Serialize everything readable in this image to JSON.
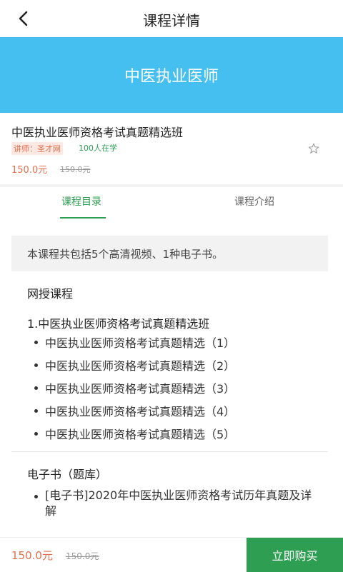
{
  "header": {
    "title": "课程详情"
  },
  "banner": {
    "text": "中医执业医师"
  },
  "course": {
    "name": "中医执业医师资格考试真题精选班",
    "teacher": "讲师：圣才网",
    "learners": "100人在学",
    "price": "150.0元",
    "original_price": "150.0元"
  },
  "tabs": [
    {
      "label": "课程目录"
    },
    {
      "label": "课程介绍"
    }
  ],
  "catalog": {
    "summary": "本课程共包括5个高清视频、1种电子书。",
    "online_section_title": "网授课程",
    "course_title": "1.中医执业医师资格考试真题精选班",
    "lessons": [
      "中医执业医师资格考试真题精选（1）",
      "中医执业医师资格考试真题精选（2）",
      "中医执业医师资格考试真题精选（3）",
      "中医执业医师资格考试真题精选（4）",
      "中医执业医师资格考试真题精选（5）"
    ],
    "ebook_section_title": "电子书（题库）",
    "ebooks": [
      "[电子书]2020年中医执业医师资格考试历年真题及详解"
    ]
  },
  "bottom_bar": {
    "price": "150.0元",
    "original_price": "150.0元",
    "buy_label": "立即购买"
  },
  "colors": {
    "banner": "#45bff0",
    "accent_green": "#2e9e53",
    "price_red": "#e46f4f"
  }
}
